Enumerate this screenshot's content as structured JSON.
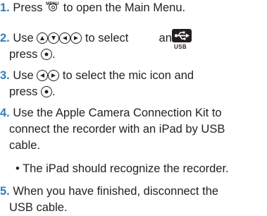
{
  "colors": {
    "step_number": "#2e7fc0",
    "text": "#231f20"
  },
  "icons": {
    "menu_key_label": "MENU",
    "usb_label": "USB"
  },
  "steps": [
    {
      "num": "1.",
      "parts": [
        "Press",
        "to open the Main Menu."
      ]
    },
    {
      "num": "2.",
      "parts": [
        "Use",
        "to select",
        "and"
      ],
      "cont": [
        "press",
        "."
      ]
    },
    {
      "num": "3.",
      "parts": [
        "Use",
        "to select the mic icon and"
      ],
      "cont": [
        "press",
        "."
      ]
    },
    {
      "num": "4.",
      "lines": [
        "Use the Apple Camera Connection Kit to",
        "connect the recorder with an iPad by USB",
        "cable."
      ]
    },
    {
      "bullet": "• The iPad should recognize the recorder."
    },
    {
      "num": "5.",
      "lines": [
        "When you have finished, disconnect the",
        "USB cable."
      ]
    }
  ]
}
